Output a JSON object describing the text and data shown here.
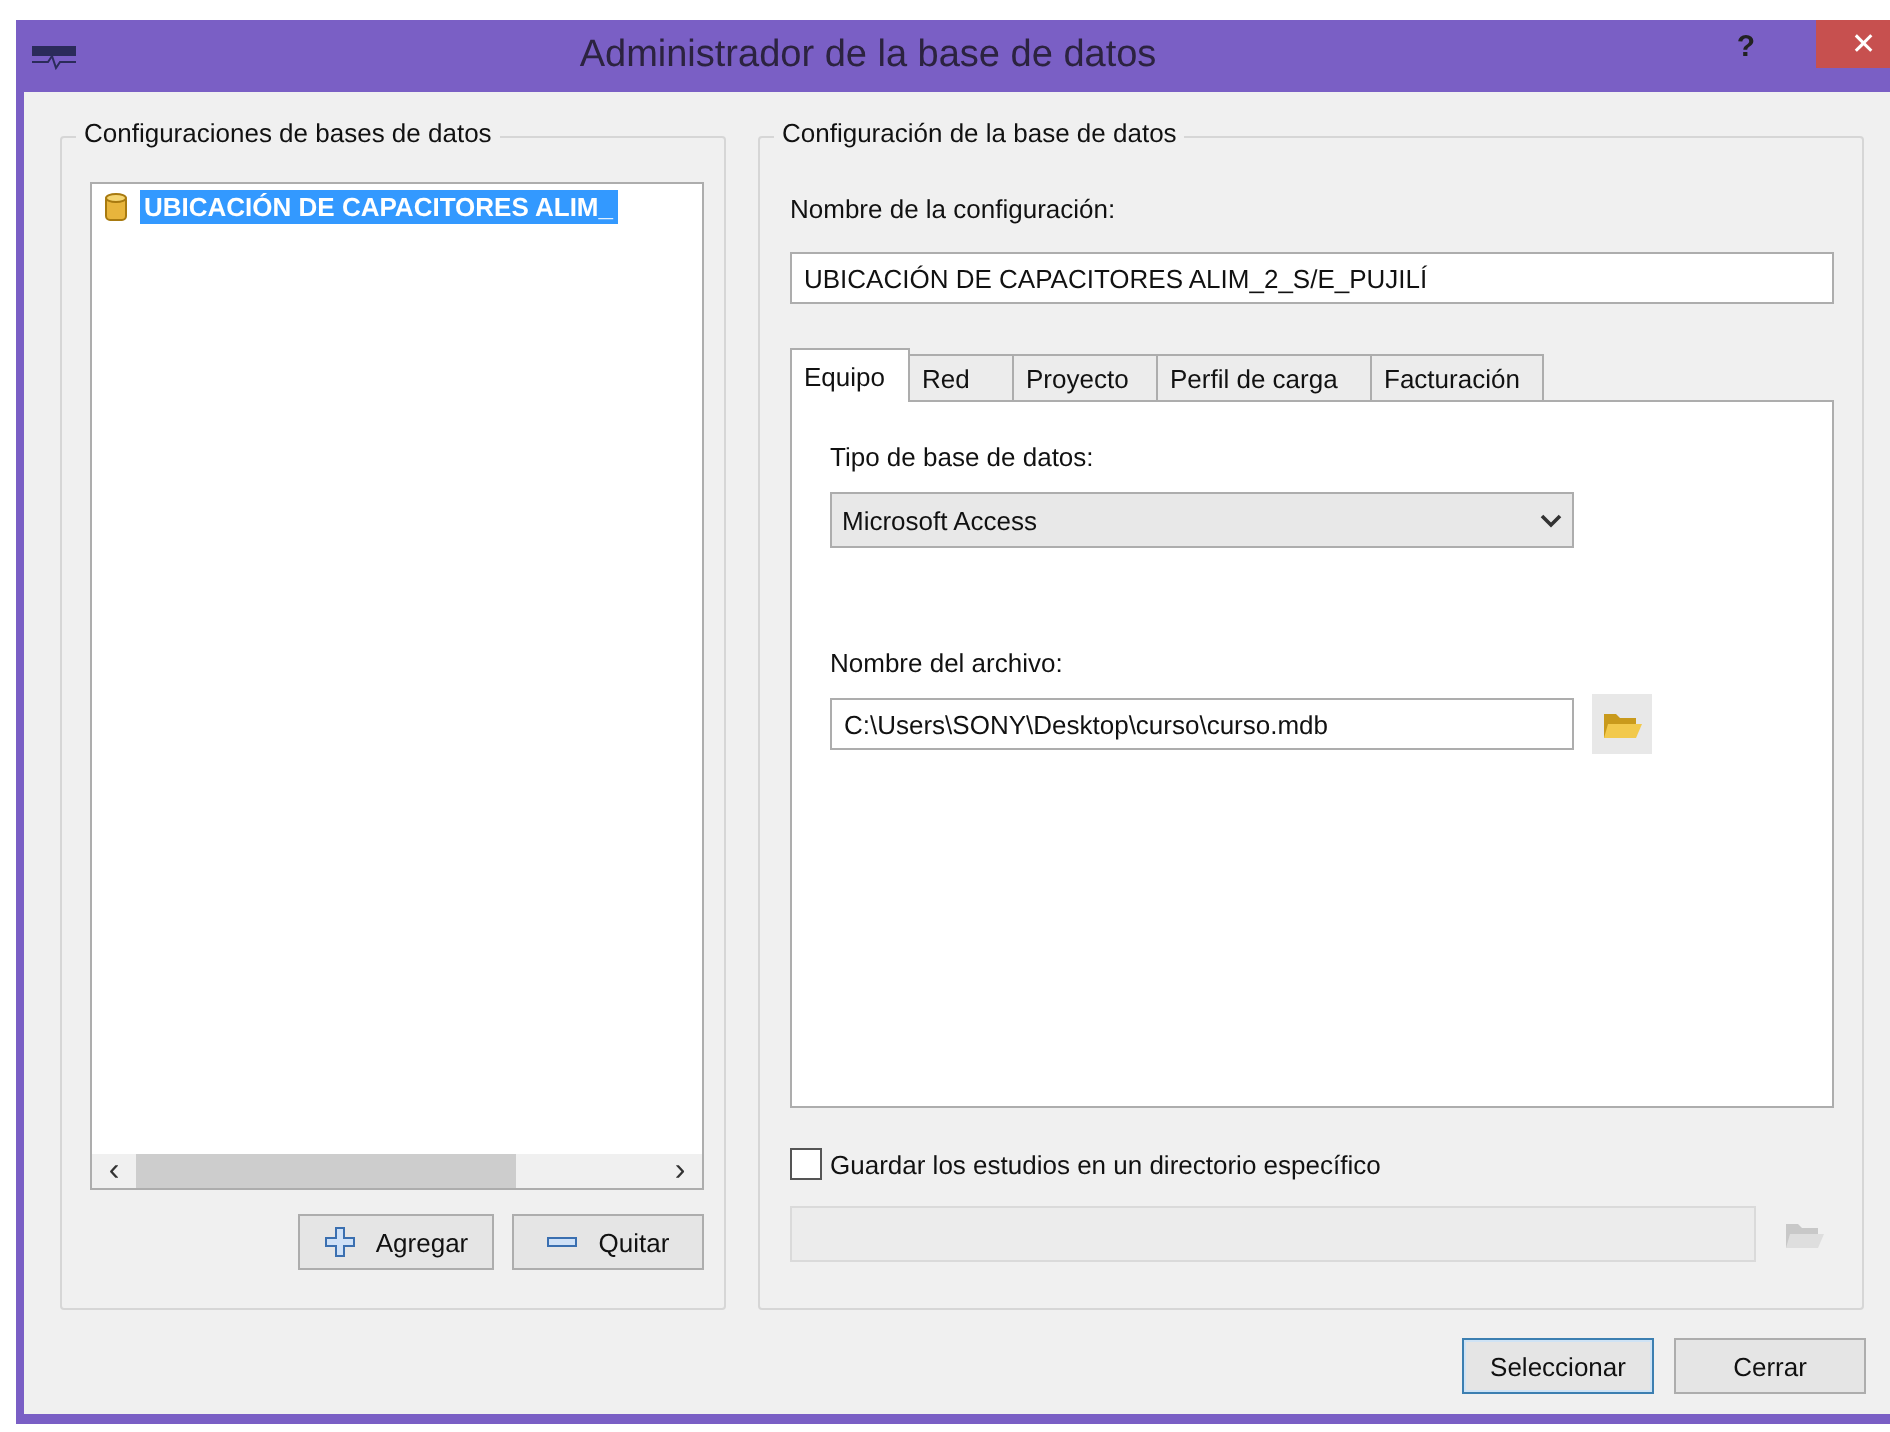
{
  "window": {
    "title": "Administrador de la base de datos",
    "help": "?",
    "close": "✕"
  },
  "left_group": {
    "legend": "Configuraciones de bases de datos",
    "items": [
      {
        "label": "UBICACIÓN DE CAPACITORES ALIM_",
        "selected": true
      }
    ],
    "scroll_left": "‹",
    "scroll_right": "›",
    "buttons": [
      {
        "label": "Agregar",
        "kind": "add"
      },
      {
        "label": "Quitar",
        "kind": "remove"
      }
    ]
  },
  "right_group": {
    "legend": "Configuración de la base de datos",
    "name_label": "Nombre de la configuración:",
    "name_value": "UBICACIÓN DE CAPACITORES ALIM_2_S/E_PUJILÍ",
    "tabs": [
      {
        "label": "Equipo",
        "selected": true
      },
      {
        "label": "Red",
        "selected": false
      },
      {
        "label": "Proyecto",
        "selected": false
      },
      {
        "label": "Perfil de carga",
        "selected": false
      },
      {
        "label": "Facturación",
        "selected": false
      }
    ],
    "db_type_label": "Tipo de base de datos:",
    "db_type_value": "Microsoft Access",
    "file_label": "Nombre del archivo:",
    "file_value": "C:\\Users\\SONY\\Desktop\\curso\\curso.mdb",
    "save_studies": {
      "label": "Guardar los estudios en un directorio específico",
      "checked": false,
      "disabled_path": true
    }
  },
  "footer_buttons": [
    {
      "label": "Seleccionar",
      "default": true
    },
    {
      "label": "Cerrar",
      "default": false
    }
  ]
}
